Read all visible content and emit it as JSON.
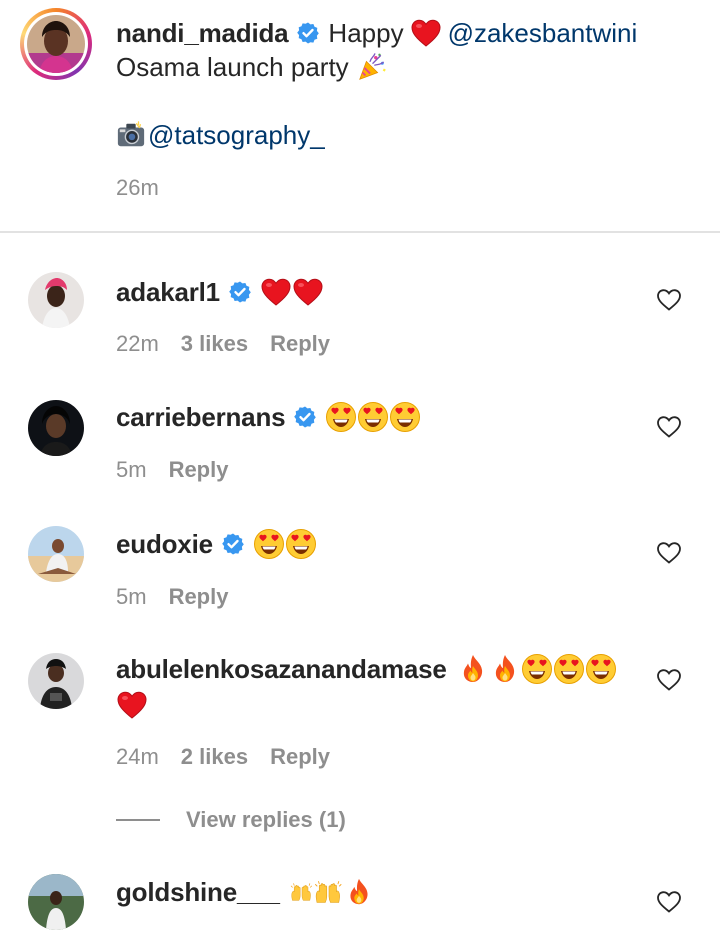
{
  "post": {
    "username": "nandi_madida",
    "caption_prefix": "Happy",
    "caption_mention": "@zakesbantwini",
    "caption_line2": "Osama launch party",
    "photo_mention": "@tatsography_",
    "time": "26m"
  },
  "comments": [
    {
      "username": "adakarl1",
      "verified": true,
      "text_emojis": [
        "heart",
        "heart"
      ],
      "time": "22m",
      "likes": "3 likes",
      "reply": "Reply"
    },
    {
      "username": "carriebernans",
      "verified": true,
      "text_emojis": [
        "heart-eyes",
        "heart-eyes",
        "heart-eyes"
      ],
      "time": "5m",
      "likes": "",
      "reply": "Reply"
    },
    {
      "username": "eudoxie",
      "verified": true,
      "text_emojis": [
        "heart-eyes",
        "heart-eyes"
      ],
      "time": "5m",
      "likes": "",
      "reply": "Reply"
    },
    {
      "username": "abulelenkosazanandamase",
      "verified": false,
      "text_emojis": [
        "fire",
        "fire",
        "heart-eyes",
        "heart-eyes",
        "heart-eyes",
        "heart"
      ],
      "time": "24m",
      "likes": "2 likes",
      "reply": "Reply",
      "view_replies": "View replies (1)"
    },
    {
      "username": "goldshine___",
      "verified": false,
      "text_emojis": [
        "raised-hands",
        "raised-hands",
        "fire"
      ],
      "time": "",
      "likes": "",
      "reply": ""
    }
  ],
  "colors": {
    "mention": "#00376b",
    "verified": "#3897f0",
    "meta": "#8e8e8e",
    "heart": "#ed1c24"
  }
}
